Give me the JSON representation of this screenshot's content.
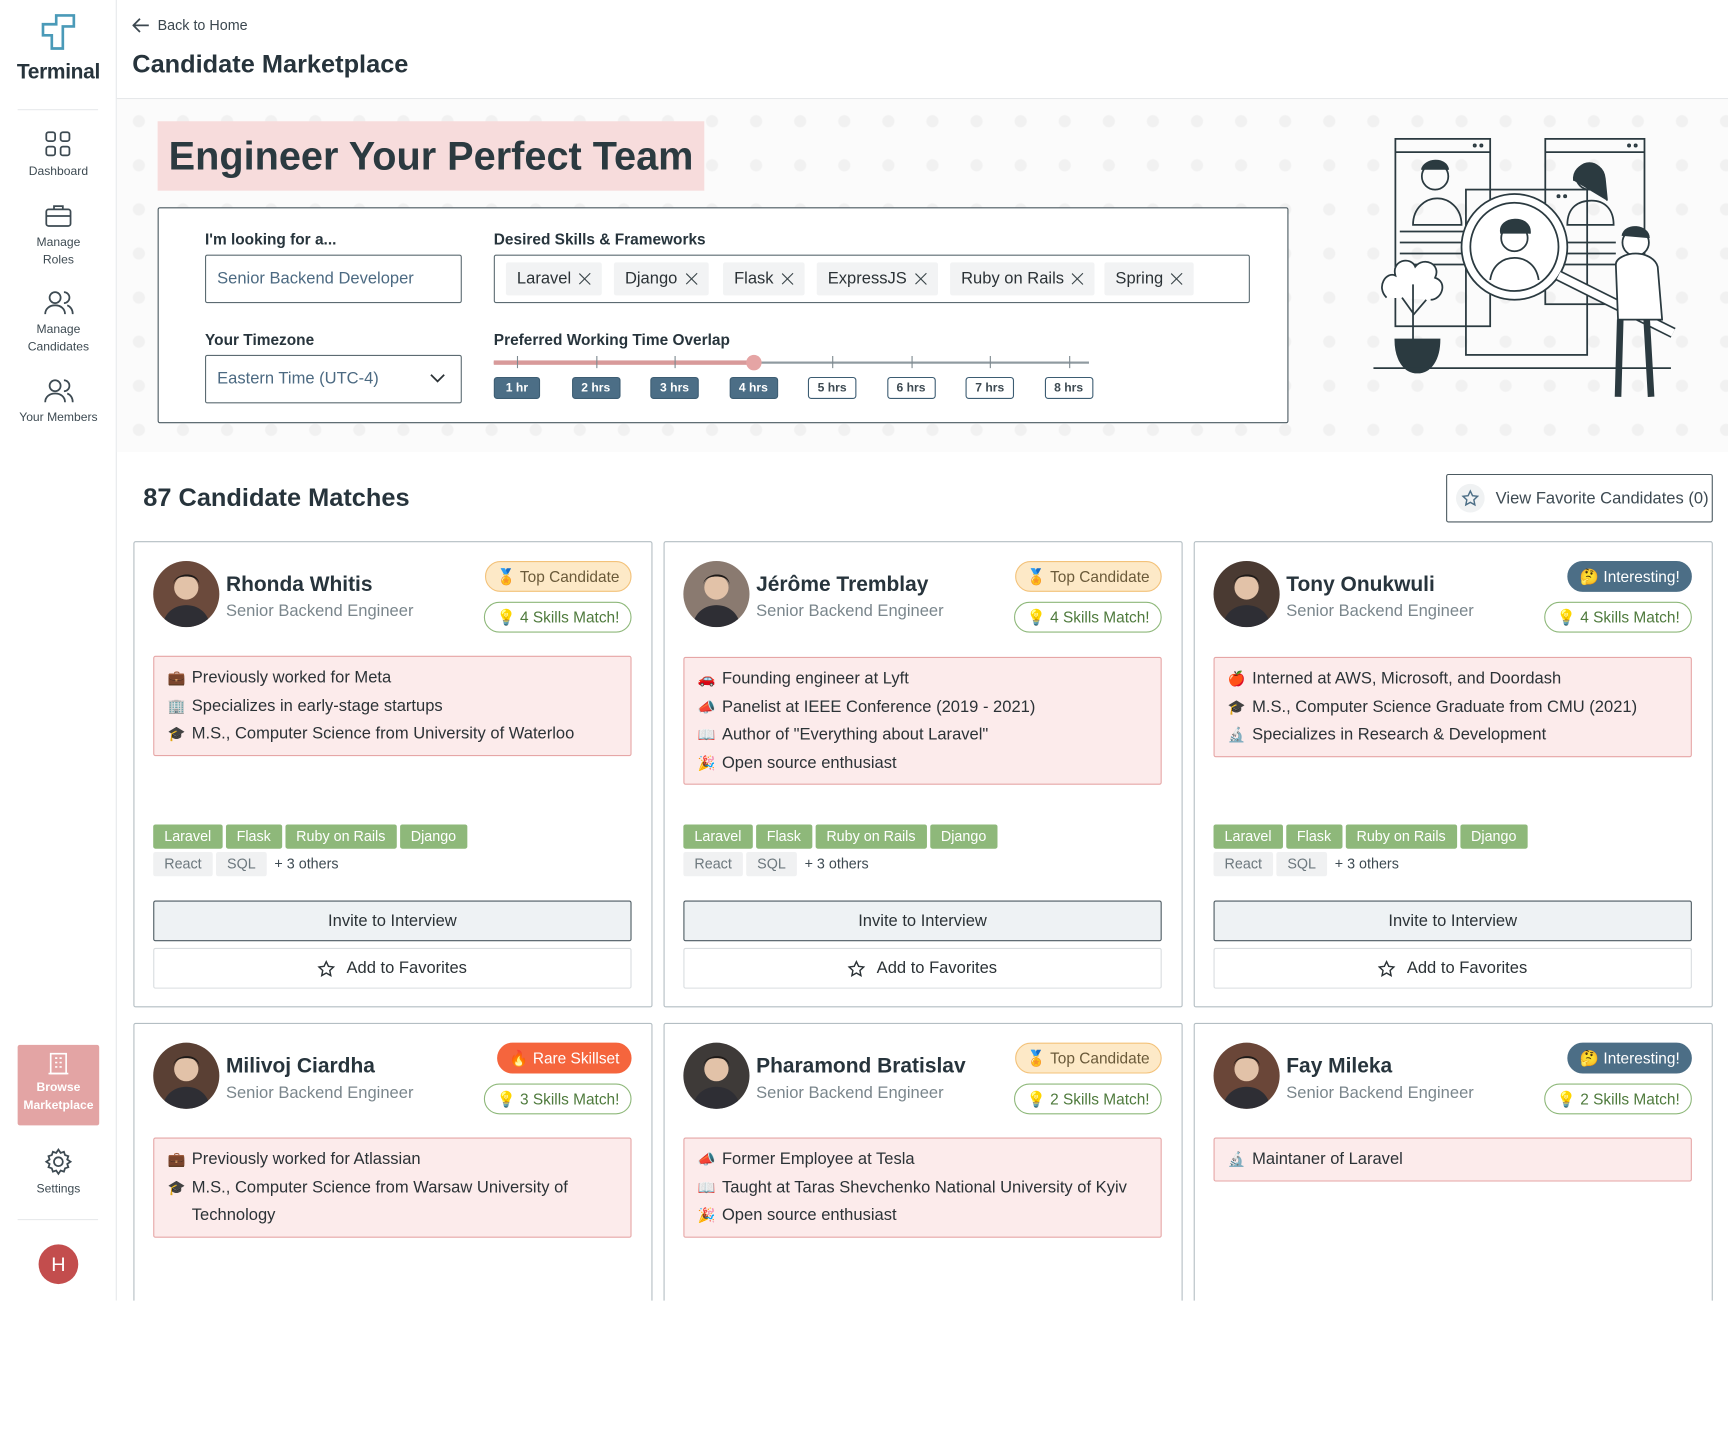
{
  "sidebar": {
    "logo_text": "Terminal",
    "items": [
      {
        "label": "Dashboard"
      },
      {
        "label": "Manage Roles"
      },
      {
        "label": "Manage Candidates"
      },
      {
        "label": "Your Members"
      }
    ],
    "browse_label": "Browse Marketplace",
    "settings_label": "Settings",
    "avatar_initial": "H"
  },
  "header": {
    "back_label": "Back to Home",
    "title": "Candidate Marketplace"
  },
  "hero": {
    "headline": "Engineer Your Perfect Team",
    "looking_label": "I'm looking for a...",
    "looking_value": "Senior Backend Developer",
    "skills_label": "Desired Skills & Frameworks",
    "skills": [
      "Laravel",
      "Django",
      "Flask",
      "ExpressJS",
      "Ruby on Rails",
      "Spring"
    ],
    "timezone_label": "Your Timezone",
    "timezone_value": "Eastern Time (UTC-4)",
    "overlap_label": "Preferred Working Time Overlap",
    "overlap_selected_hours": 4,
    "overlap_options": [
      "1 hr",
      "2 hrs",
      "3 hrs",
      "4 hrs",
      "5 hrs",
      "6 hrs",
      "7 hrs",
      "8 hrs"
    ]
  },
  "results": {
    "count_label": "87 Candidate Matches",
    "favorites_label": "View Favorite Candidates (0)",
    "invite_label": "Invite to Interview",
    "add_fav_label": "Add to Favorites"
  },
  "candidates": [
    {
      "name": "Rhonda Whitis",
      "role": "Senior Backend Engineer",
      "badge": "🏅 Top Candidate",
      "badge_type": "top",
      "skills_match": "💡 4 Skills Match!",
      "highlights": [
        {
          "emoji": "💼",
          "text": "Previously worked for Meta"
        },
        {
          "emoji": "🏢",
          "text": "Specializes in early-stage startups"
        },
        {
          "emoji": "🎓",
          "text": "M.S., Computer Science from University of Waterloo"
        }
      ],
      "matched_skills": [
        "Laravel",
        "Flask",
        "Ruby on Rails",
        "Django"
      ],
      "other_skills": [
        "React",
        "SQL"
      ],
      "others_label": "+ 3 others",
      "avatar_color": "#6b4a3c"
    },
    {
      "name": "Jérôme Tremblay",
      "role": "Senior Backend Engineer",
      "badge": "🏅 Top Candidate",
      "badge_type": "top",
      "skills_match": "💡 4 Skills Match!",
      "highlights": [
        {
          "emoji": "🚗",
          "text": "Founding engineer at Lyft"
        },
        {
          "emoji": "📣",
          "text": "Panelist at IEEE Conference (2019 - 2021)"
        },
        {
          "emoji": "📖",
          "text": "Author of \"Everything about Laravel\""
        },
        {
          "emoji": "🎉",
          "text": "Open source enthusiast"
        }
      ],
      "matched_skills": [
        "Laravel",
        "Flask",
        "Ruby on Rails",
        "Django"
      ],
      "other_skills": [
        "React",
        "SQL"
      ],
      "others_label": "+ 3 others",
      "avatar_color": "#8a7a70"
    },
    {
      "name": "Tony Onukwuli",
      "role": "Senior Backend Engineer",
      "badge": "🤔 Interesting!",
      "badge_type": "int",
      "skills_match": "💡 4 Skills Match!",
      "highlights": [
        {
          "emoji": "🍎",
          "text": "Interned at AWS, Microsoft, and Doordash"
        },
        {
          "emoji": "🎓",
          "text": "M.S., Computer Science Graduate from CMU (2021)"
        },
        {
          "emoji": "🔬",
          "text": "Specializes in Research & Development"
        }
      ],
      "matched_skills": [
        "Laravel",
        "Flask",
        "Ruby on Rails",
        "Django"
      ],
      "other_skills": [
        "React",
        "SQL"
      ],
      "others_label": "+ 3 others",
      "avatar_color": "#4a3a32"
    },
    {
      "name": "Milivoj Ciardha",
      "role": "Senior Backend Engineer",
      "badge": "🔥 Rare Skillset",
      "badge_type": "rare",
      "skills_match": "💡 3 Skills Match!",
      "highlights": [
        {
          "emoji": "💼",
          "text": "Previously worked for Atlassian"
        },
        {
          "emoji": "🎓",
          "text": "M.S., Computer Science from Warsaw University of Technology"
        }
      ],
      "avatar_color": "#5a4034"
    },
    {
      "name": "Pharamond Bratislav",
      "role": "Senior Backend Engineer",
      "badge": "🏅 Top Candidate",
      "badge_type": "top",
      "skills_match": "💡 2 Skills Match!",
      "highlights": [
        {
          "emoji": "📣",
          "text": "Former Employee at Tesla"
        },
        {
          "emoji": "📖",
          "text": "Taught at Taras Shevchenko National University of Kyiv"
        },
        {
          "emoji": "🎉",
          "text": "Open source enthusiast"
        }
      ],
      "avatar_color": "#3e3a38"
    },
    {
      "name": "Fay Mileka",
      "role": "Senior Backend Engineer",
      "badge": "🤔 Interesting!",
      "badge_type": "int",
      "skills_match": "💡 2 Skills Match!",
      "highlights": [
        {
          "emoji": "🔬",
          "text": "Maintaner of Laravel"
        }
      ],
      "avatar_color": "#6a4638"
    }
  ]
}
